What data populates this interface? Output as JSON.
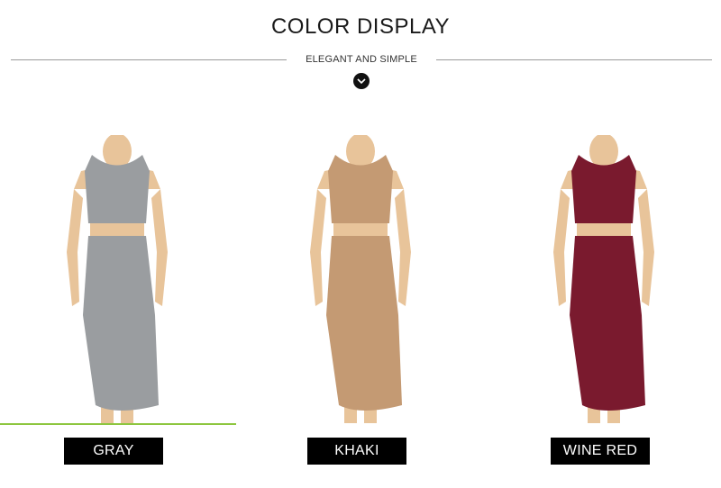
{
  "header": {
    "title": "COLOR DISPLAY",
    "subtitle": "ELEGANT AND SIMPLE",
    "scroll_icon": "chevron-down-icon"
  },
  "products": [
    {
      "label": "GRAY",
      "color": "#9a9da0"
    },
    {
      "label": "KHAKI",
      "color": "#c49a73"
    },
    {
      "label": "WINE RED",
      "color": "#7a1a2e"
    }
  ],
  "skin_color": "#e8c49a",
  "accent_line_color": "#8dc63f"
}
